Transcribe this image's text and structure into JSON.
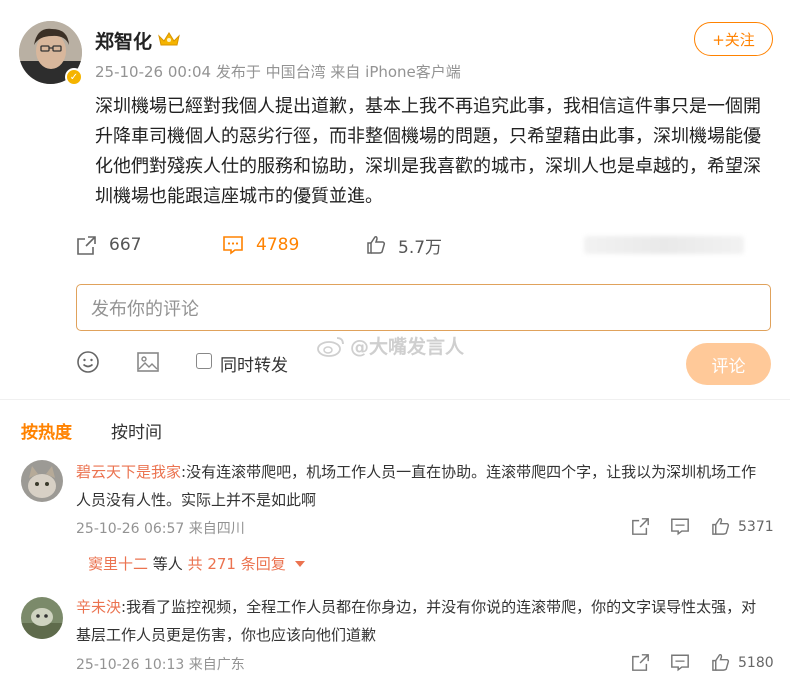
{
  "post": {
    "author": "郑智化",
    "meta": "25-10-26 00:04  发布于 中国台湾  来自 iPhone客户端",
    "follow_label": "+关注",
    "text": "深圳機場已經對我個人提出道歉，基本上我不再追究此事，我相信這件事只是一個開升降車司機個人的惡劣行徑，而非整個機場的問題，只希望藉由此事，深圳機場能優化他們對殘疾人仕的服務和協助，深圳是我喜歡的城市，深圳人也是卓越的，希望深圳機場也能跟這座城市的優質並進。",
    "reposts": "667",
    "comments": "4789",
    "likes": "5.7万"
  },
  "composer": {
    "placeholder": "发布你的评论",
    "repost_label": "同时转发",
    "submit_label": "评论",
    "watermark": "@大嘴发言人"
  },
  "sort": {
    "hot": "按热度",
    "time": "按时间"
  },
  "comments": [
    {
      "user": "碧云天下是我家",
      "text": ":没有连滚带爬吧，机场工作人员一直在协助。连滚带爬四个字，让我以为深圳机场工作人员没有人性。实际上并不是如此啊",
      "meta": "25-10-26 06:57 来自四川",
      "likes": "5371",
      "reply_user": "窦里十二",
      "reply_mid": " 等人 ",
      "reply_count": "共 271 条回复"
    },
    {
      "user": "辛未泱",
      "text": ":我看了监控视频，全程工作人员都在你身边，并没有你说的连滚带爬，你的文字误导性太强，对基层工作人员更是伤害，你也应该向他们道歉",
      "meta": "25-10-26 10:13 来自广东",
      "likes": "5180"
    }
  ],
  "colors": {
    "accent": "#ff8200",
    "username": "#eb7350",
    "muted": "#939393"
  }
}
